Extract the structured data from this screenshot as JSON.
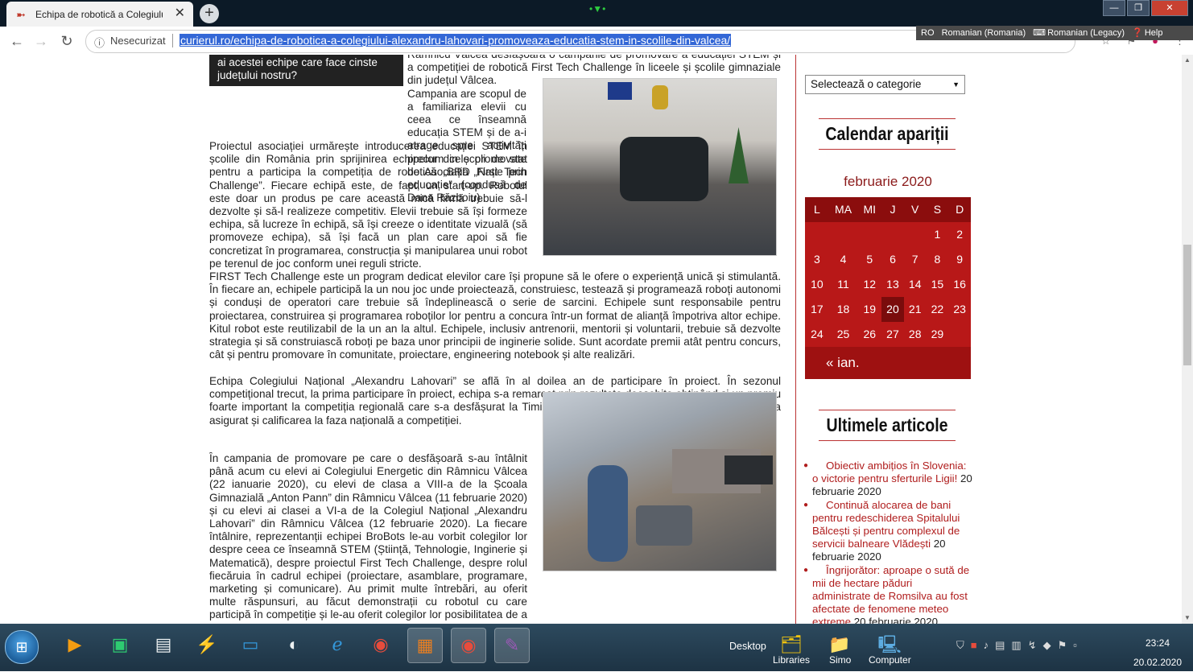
{
  "browser": {
    "tab_title": "Echipa de robotică a Colegiului ...",
    "tab_close": "✕",
    "new_tab": "+",
    "security_label": "Nesecurizat",
    "url": "curierul.ro/echipa-de-robotica-a-colegiului-alexandru-lahovari-promoveaza-educatia-stem-in-scolile-din-valcea/",
    "language_bar": {
      "code": "RO",
      "language": "Romanian (Romania)",
      "layout": "Romanian (Legacy)",
      "help": "Help"
    }
  },
  "article": {
    "box_text": "ai acestei echipe care face cinste județului nostru?",
    "p1": "Râmnicu Vâlcea desfășoară o campanie de promovare a educației STEM și a competiției de robotică First Tech Challenge în liceele și școlile gimnaziale din județul Vâlcea.",
    "p2": "Campania are scopul de a familiariza elevii cu ceea ce înseamnă educația STEM și de a-i atrage spre activități precum cele promovate de Asociația „Nație prin educație” (condusă de Dana Războiu).",
    "p3": "Proiectul asociației urmărește introducerea educației STEM în școlile din România prin sprijinirea echipelor din școli de stat pentru a participa la competiția de robotică „BRD First Tech Challenge”. Fiecare echipă este, de fapt, un start-up. Robotul este doar un produs pe care această mică firmă trebuie să-l dezvolte și să-l realizeze competitiv. Elevii trebuie să își formeze echipa, să lucreze în echipă, să își creeze o identitate vizuală (să promoveze echipa), să își facă un plan care apoi să fie concretizat în programarea, construcția și manipularea unui robot pe terenul de joc conform unei reguli stricte.",
    "p4": "FIRST Tech Challenge este un program dedicat elevilor care își propune să le ofere o experiență unică și stimulantă. În fiecare an, echipele participă la un nou joc unde proiectează, construiesc, testează și programează roboți autonomi și conduși de operatori care trebuie să îndeplinească o serie de sarcini. Echipele sunt responsabile pentru proiectarea, construirea și programarea roboților lor pentru a concura într-un format de alianță împotriva altor echipe. Kitul robot este reutilizabil de la un an la altul. Echipele, inclusiv antrenorii, mentorii și voluntarii, trebuie să dezvolte strategia și să construiască roboți pe baza unor principii de inginerie solide. Sunt acordate premii atât pentru concurs, cât și pentru promovare în comunitate, proiectare, engineering notebook și alte realizări.",
    "p5": "Echipa Colegiului Național „Alexandru Lahovari” se află în al doilea an de participare în proiect. În sezonul competițional trecut, la prima participare în proiect, echipa s-a remarcat prin rezultate deosebite obținând și un premiu foarte important la competiția regională care s-a desfășurat la Timișoara – Premiul II Think Award, premiu care i-a asigurat și calificarea la faza națională a competiției.",
    "p6": "În campania de promovare pe care o desfășoară s-au întâlnit până acum cu elevi ai Colegiului Energetic din Râmnicu Vâlcea (22 ianuarie 2020), cu elevi de clasa a VIII-a de la Școala Gimnazială „Anton Pann” din Râmnicu Vâlcea (11 februarie 2020) și cu elevi ai clasei a VI-a de la Colegiul Național „Alexandru Lahovari” din Râmnicu Vâlcea (12 februarie 2020). La fiecare întâlnire, reprezentanții echipei BroBots le-au vorbit colegilor lor despre ceea ce înseamnă STEM (Știință, Tehnologie, Inginerie și Matematică), despre proiectul First Tech Challenge, despre rolul fiecăruia în cadrul echipei (proiectare, asamblare, programare, marketing și comunicare). Au primit multe întrebări, au oferit multe răspunsuri, au făcut demonstrații cu robotul cu care participă în competiție și le-au oferit colegilor lor posibilitatea de a menevra robotul. Peste tot prezentările lor au fost primite cu interes și entuziasm. Cu siguranță, printre participanții la aceste"
  },
  "sidebar": {
    "category_select": "Selectează o categorie",
    "calendar_title": "Calendar apariții",
    "calendar_caption": "februarie 2020",
    "weekdays": [
      "L",
      "MA",
      "MI",
      "J",
      "V",
      "S",
      "D"
    ],
    "weeks": [
      [
        "",
        "",
        "",
        "",
        "",
        "1",
        "2"
      ],
      [
        "3",
        "4",
        "5",
        "6",
        "7",
        "8",
        "9"
      ],
      [
        "10",
        "11",
        "12",
        "13",
        "14",
        "15",
        "16"
      ],
      [
        "17",
        "18",
        "19",
        "20",
        "21",
        "22",
        "23"
      ],
      [
        "24",
        "25",
        "26",
        "27",
        "28",
        "29",
        ""
      ]
    ],
    "prev_month": "« ian.",
    "latest_title": "Ultimele articole",
    "posts": [
      {
        "title": "Obiectiv ambițios în Slovenia: o victorie pentru sferturile Ligii!",
        "date": "20 februarie 2020"
      },
      {
        "title": "Continuă alocarea de bani pentru redeschiderea Spitalului Bălcești și pentru complexul de servicii balneare Vlădești",
        "date": "20 februarie 2020"
      },
      {
        "title": "Îngrijorător: aproape o sută de mii de hectare păduri administrate de Romsilva au fost afectate de fenomene meteo extreme",
        "date": "20 februarie 2020"
      }
    ]
  },
  "taskbar": {
    "desktop_label": "Desktop",
    "apps": [
      "Libraries",
      "Simo",
      "Computer"
    ],
    "time": "23:24",
    "date": "20.02.2020"
  }
}
